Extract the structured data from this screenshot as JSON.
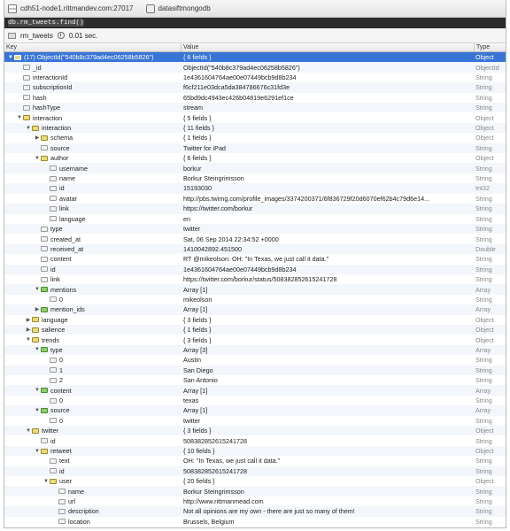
{
  "window": {
    "server": "cdh51-node1.rittmandev.com:27017",
    "database": "datasiftmongodb"
  },
  "query": "db.rm_tweets.find()",
  "results": {
    "collection": "rm_tweets",
    "time": "0.01 sec."
  },
  "columns": {
    "key": "Key",
    "value": "Value",
    "type": "Type"
  },
  "rows": [
    {
      "depth": 0,
      "toggle": "open",
      "icon": "obj",
      "key": "(17) ObjectId(\"540b8c379ad4ec06258b5826\")",
      "value": "{ 6 fields }",
      "type": "Object",
      "selected": true
    },
    {
      "depth": 1,
      "toggle": "",
      "icon": "field",
      "key": "_id",
      "value": "ObjectId(\"540b8c379ad4ec06258b5826\")",
      "type": "ObjectId"
    },
    {
      "depth": 1,
      "toggle": "",
      "icon": "field",
      "key": "interactionId",
      "value": "1e4361604764ae00e07449bcb9d8b234",
      "type": "String"
    },
    {
      "depth": 1,
      "toggle": "",
      "icon": "field",
      "key": "subscriptionId",
      "value": "f6cf211e03dca5da384786676c31fd3e",
      "type": "String"
    },
    {
      "depth": 1,
      "toggle": "",
      "icon": "field",
      "key": "hash",
      "value": "65bd9dc4943ec426b04819e6291ef1ce",
      "type": "String"
    },
    {
      "depth": 1,
      "toggle": "",
      "icon": "field",
      "key": "hashType",
      "value": "stream",
      "type": "String"
    },
    {
      "depth": 1,
      "toggle": "open",
      "icon": "obj",
      "key": "interaction",
      "value": "{ 5 fields }",
      "type": "Object"
    },
    {
      "depth": 2,
      "toggle": "open",
      "icon": "obj",
      "key": "interaction",
      "value": "{ 11 fields }",
      "type": "Object"
    },
    {
      "depth": 3,
      "toggle": "closed",
      "icon": "obj",
      "key": "schema",
      "value": "{ 1 fields }",
      "type": "Object"
    },
    {
      "depth": 3,
      "toggle": "",
      "icon": "field",
      "key": "source",
      "value": "Twitter for iPad",
      "type": "String"
    },
    {
      "depth": 3,
      "toggle": "open",
      "icon": "obj",
      "key": "author",
      "value": "{ 6 fields }",
      "type": "Object"
    },
    {
      "depth": 4,
      "toggle": "",
      "icon": "field",
      "key": "username",
      "value": "borkur",
      "type": "String"
    },
    {
      "depth": 4,
      "toggle": "",
      "icon": "field",
      "key": "name",
      "value": "Borkur Steingrimsson",
      "type": "String"
    },
    {
      "depth": 4,
      "toggle": "",
      "icon": "field",
      "key": "id",
      "value": "15193030",
      "type": "Int32"
    },
    {
      "depth": 4,
      "toggle": "",
      "icon": "field",
      "key": "avatar",
      "value": "http://pbs.twimg.com/profile_images/3374200371/6f836729f20d6070ef62b4c79d6e14...",
      "type": "String"
    },
    {
      "depth": 4,
      "toggle": "",
      "icon": "field",
      "key": "link",
      "value": "https://twitter.com/borkur",
      "type": "String"
    },
    {
      "depth": 4,
      "toggle": "",
      "icon": "field",
      "key": "language",
      "value": "en",
      "type": "String"
    },
    {
      "depth": 3,
      "toggle": "",
      "icon": "field",
      "key": "type",
      "value": "twitter",
      "type": "String"
    },
    {
      "depth": 3,
      "toggle": "",
      "icon": "field",
      "key": "created_at",
      "value": "Sat, 06 Sep 2014 22:34:52 +0000",
      "type": "String"
    },
    {
      "depth": 3,
      "toggle": "",
      "icon": "field",
      "key": "received_at",
      "value": "1410042892.451500",
      "type": "Double"
    },
    {
      "depth": 3,
      "toggle": "",
      "icon": "field",
      "key": "content",
      "value": "RT @mikeolson: OH: \"In Texas, we just call it data.\"",
      "type": "String"
    },
    {
      "depth": 3,
      "toggle": "",
      "icon": "field",
      "key": "id",
      "value": "1e4361604764ae00e07449bcb9d8b234",
      "type": "String"
    },
    {
      "depth": 3,
      "toggle": "",
      "icon": "field",
      "key": "link",
      "value": "https://twitter.com/borkur/status/508382852615241728",
      "type": "String"
    },
    {
      "depth": 3,
      "toggle": "open",
      "icon": "arr",
      "key": "mentions",
      "value": "Array [1]",
      "type": "Array"
    },
    {
      "depth": 4,
      "toggle": "",
      "icon": "field",
      "key": "0",
      "value": "mikeolson",
      "type": "String"
    },
    {
      "depth": 3,
      "toggle": "closed",
      "icon": "arr",
      "key": "mention_ids",
      "value": "Array [1]",
      "type": "Array"
    },
    {
      "depth": 2,
      "toggle": "closed",
      "icon": "obj",
      "key": "language",
      "value": "{ 3 fields }",
      "type": "Object"
    },
    {
      "depth": 2,
      "toggle": "closed",
      "icon": "obj",
      "key": "salience",
      "value": "{ 1 fields }",
      "type": "Object"
    },
    {
      "depth": 2,
      "toggle": "open",
      "icon": "obj",
      "key": "trends",
      "value": "{ 3 fields }",
      "type": "Object"
    },
    {
      "depth": 3,
      "toggle": "open",
      "icon": "arr",
      "key": "type",
      "value": "Array [3]",
      "type": "Array"
    },
    {
      "depth": 4,
      "toggle": "",
      "icon": "field",
      "key": "0",
      "value": "Austin",
      "type": "String"
    },
    {
      "depth": 4,
      "toggle": "",
      "icon": "field",
      "key": "1",
      "value": "San Diego",
      "type": "String"
    },
    {
      "depth": 4,
      "toggle": "",
      "icon": "field",
      "key": "2",
      "value": "San Antonio",
      "type": "String"
    },
    {
      "depth": 3,
      "toggle": "open",
      "icon": "arr",
      "key": "content",
      "value": "Array [1]",
      "type": "Array"
    },
    {
      "depth": 4,
      "toggle": "",
      "icon": "field",
      "key": "0",
      "value": "texas",
      "type": "String"
    },
    {
      "depth": 3,
      "toggle": "open",
      "icon": "arr",
      "key": "source",
      "value": "Array [1]",
      "type": "Array"
    },
    {
      "depth": 4,
      "toggle": "",
      "icon": "field",
      "key": "0",
      "value": "twitter",
      "type": "String"
    },
    {
      "depth": 2,
      "toggle": "open",
      "icon": "obj",
      "key": "twitter",
      "value": "{ 3 fields }",
      "type": "Object"
    },
    {
      "depth": 3,
      "toggle": "",
      "icon": "field",
      "key": "id",
      "value": "508382852615241728",
      "type": "String"
    },
    {
      "depth": 3,
      "toggle": "open",
      "icon": "obj",
      "key": "retweet",
      "value": "{ 10 fields }",
      "type": "Object"
    },
    {
      "depth": 4,
      "toggle": "",
      "icon": "field",
      "key": "text",
      "value": "OH: \"In Texas, we just call it data.\"",
      "type": "String"
    },
    {
      "depth": 4,
      "toggle": "",
      "icon": "field",
      "key": "id",
      "value": "508382852615241728",
      "type": "String"
    },
    {
      "depth": 4,
      "toggle": "open",
      "icon": "obj",
      "key": "user",
      "value": "{ 20 fields }",
      "type": "Object"
    },
    {
      "depth": 5,
      "toggle": "",
      "icon": "field",
      "key": "name",
      "value": "Borkur Steingrimsson",
      "type": "String"
    },
    {
      "depth": 5,
      "toggle": "",
      "icon": "field",
      "key": "url",
      "value": "http://www.rittmanmead.com",
      "type": "String"
    },
    {
      "depth": 5,
      "toggle": "",
      "icon": "field",
      "key": "description",
      "value": "Not all opinions are my own - there are just so many of them!",
      "type": "String"
    },
    {
      "depth": 5,
      "toggle": "",
      "icon": "field",
      "key": "location",
      "value": "Brussels, Belgium",
      "type": "String"
    }
  ]
}
